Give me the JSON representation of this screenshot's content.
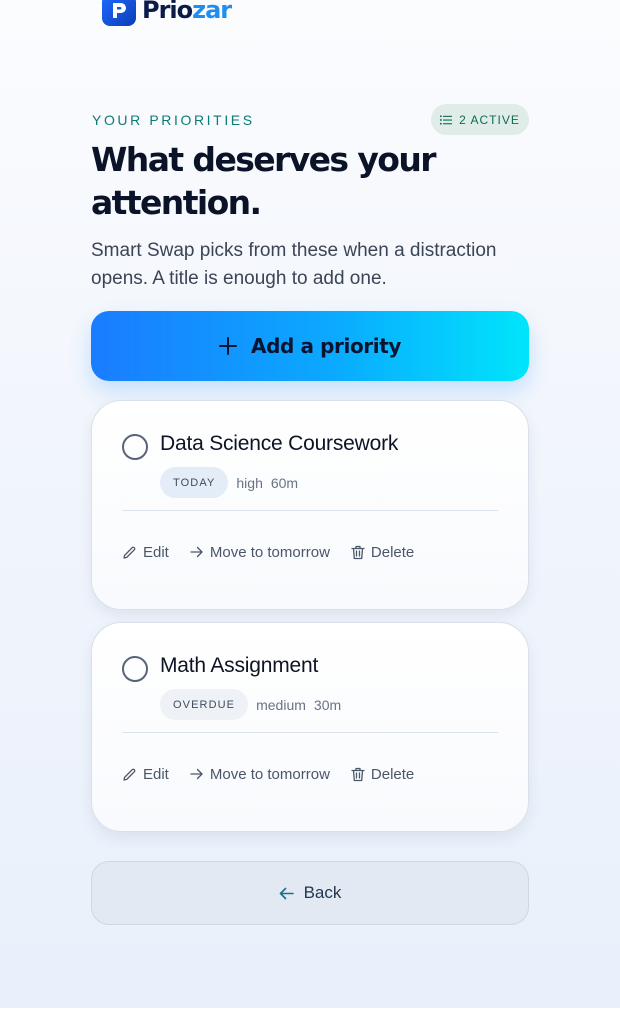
{
  "brand": {
    "name_part1": "Prio",
    "name_part2": "zar"
  },
  "header": {
    "eyebrow": "YOUR PRIORITIES",
    "active_badge": "2 ACTIVE",
    "title": "What deserves your attention.",
    "subtitle": "Smart Swap picks from these when a distraction opens. A title is enough to add one."
  },
  "add_button": {
    "label": "Add a priority"
  },
  "priorities": [
    {
      "title": "Data Science Coursework",
      "tag": "TODAY",
      "importance": "high",
      "duration": "60m",
      "actions": {
        "edit": "Edit",
        "move": "Move to tomorrow",
        "delete": "Delete"
      }
    },
    {
      "title": "Math Assignment",
      "tag": "OVERDUE",
      "importance": "medium",
      "duration": "30m",
      "actions": {
        "edit": "Edit",
        "move": "Move to tomorrow",
        "delete": "Delete"
      }
    }
  ],
  "back_button": {
    "label": "Back"
  },
  "colors": {
    "accent_start": "#1a7cff",
    "accent_end": "#00e5fb",
    "eyebrow_teal": "#0c7b78",
    "badge_bg": "#dfece8",
    "heading": "#0b1329"
  }
}
